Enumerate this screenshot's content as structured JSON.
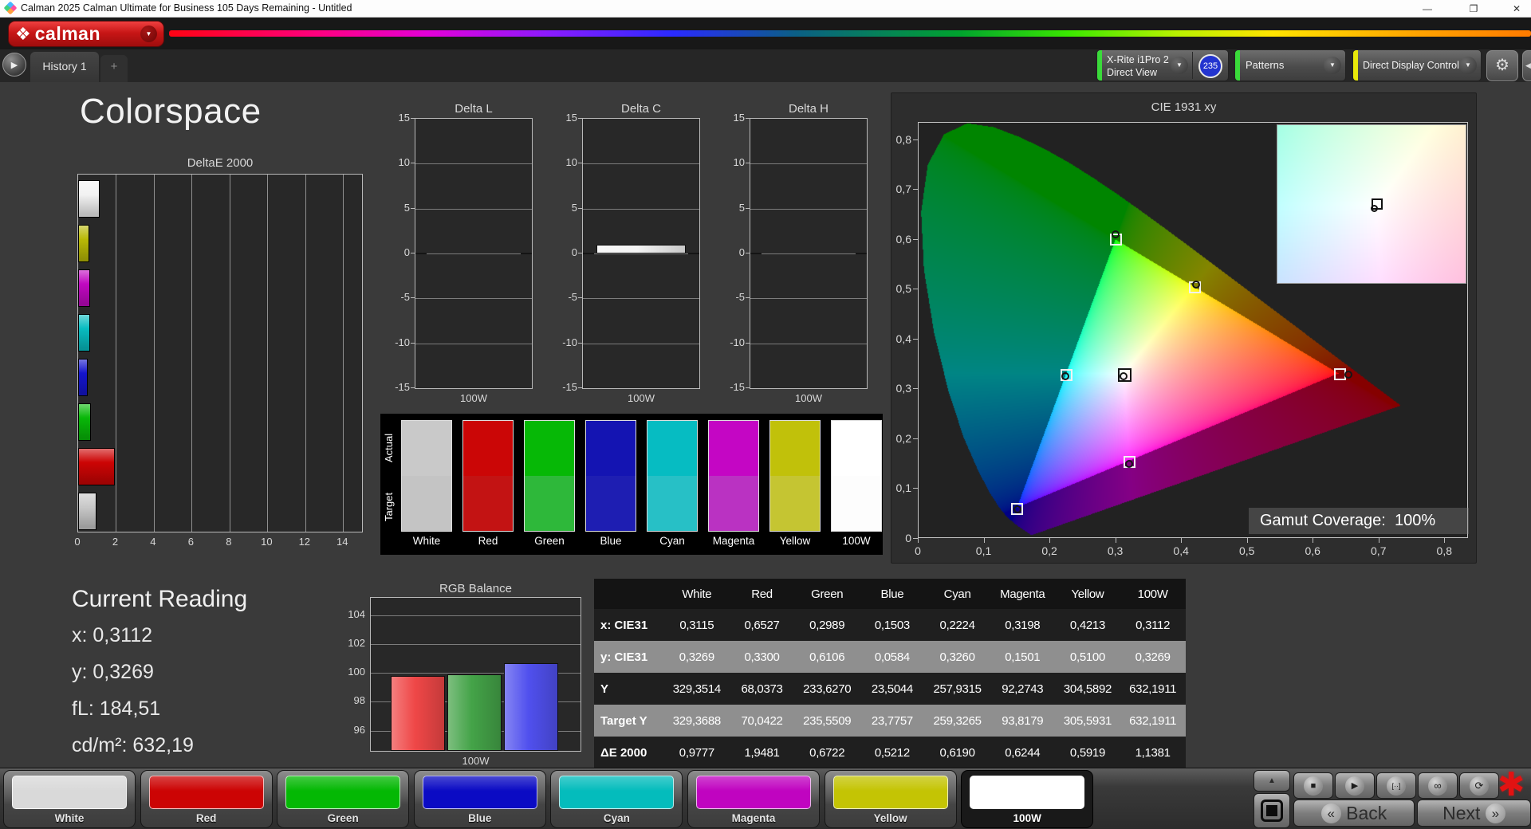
{
  "title_bar": {
    "title": "Calman 2025 Calman Ultimate for Business 105 Days Remaining  - Untitled"
  },
  "icons": {
    "logo_glyph": "❖",
    "chevron_down": "▼",
    "tab_arrow": "▶",
    "add": "+",
    "minimize": "—",
    "restore": "❐",
    "close": "✕",
    "gear": "⚙",
    "collapse_left": "◀",
    "up": "▲",
    "stop": "■",
    "play": "▶",
    "step": "[··]",
    "infinity": "∞",
    "loop": "⟳",
    "asterisk": "✱",
    "back_chevrons": "«",
    "next_chevrons": "»"
  },
  "header": {
    "logo_text": "calman"
  },
  "tab_bar": {
    "history_tab": "History 1",
    "add_tab": "+"
  },
  "toolbar": {
    "meter": {
      "line1": "X-Rite i1Pro 2",
      "line2": "Direct View",
      "badge": "235",
      "accent": "#3ada3a"
    },
    "patterns": {
      "label": "Patterns",
      "accent": "#3ada3a"
    },
    "display_control": {
      "label": "Direct Display Control",
      "accent": "#e8e80a"
    }
  },
  "page": {
    "title": "Colorspace"
  },
  "charts": {
    "delta_e": {
      "type": "bar",
      "title": "DeltaE 2000",
      "xlim": [
        0,
        15
      ],
      "x_ticks": [
        "0",
        "2",
        "4",
        "6",
        "8",
        "10",
        "12",
        "14"
      ],
      "bars": [
        {
          "name": "100W",
          "color": "#f2f2f2",
          "value": 1.1381
        },
        {
          "name": "Yellow",
          "color": "#b9b906",
          "value": 0.5919
        },
        {
          "name": "Magenta",
          "color": "#c008c0",
          "value": 0.6244
        },
        {
          "name": "Cyan",
          "color": "#08bcc0",
          "value": 0.619
        },
        {
          "name": "Blue",
          "color": "#1414cc",
          "value": 0.5212
        },
        {
          "name": "Green",
          "color": "#08b808",
          "value": 0.6722
        },
        {
          "name": "Red",
          "color": "#cc0404",
          "value": 1.9481
        },
        {
          "name": "White",
          "color": "#c8c8c8",
          "value": 0.9777
        }
      ]
    },
    "delta_lch": {
      "type": "bar",
      "ylim": [
        -15,
        15
      ],
      "y_ticks": [
        15,
        10,
        5,
        0,
        -5,
        -10,
        -15
      ],
      "xlabel": "100W",
      "charts": [
        {
          "title": "Delta L",
          "value": 0
        },
        {
          "title": "Delta C",
          "value": 1.0
        },
        {
          "title": "Delta H",
          "value": 0
        }
      ]
    },
    "actual_target": {
      "row_labels": [
        "Actual",
        "Target"
      ],
      "columns": [
        {
          "label": "White",
          "actual": "#c9c9c9",
          "target": "#c4c4c4"
        },
        {
          "label": "Red",
          "actual": "#cb0606",
          "target": "#c31313"
        },
        {
          "label": "Green",
          "actual": "#06b806",
          "target": "#2eb83a"
        },
        {
          "label": "Blue",
          "actual": "#1414b2",
          "target": "#1e1eb2"
        },
        {
          "label": "Cyan",
          "actual": "#06bcc2",
          "target": "#27c0c6"
        },
        {
          "label": "Magenta",
          "actual": "#c406c4",
          "target": "#ba32c2"
        },
        {
          "label": "Yellow",
          "actual": "#c1c10a",
          "target": "#c5c532"
        },
        {
          "label": "100W",
          "actual": "#ffffff",
          "target": "#fdfdfd"
        }
      ]
    },
    "rgb_balance": {
      "type": "bar",
      "title": "RGB Balance",
      "xlabel": "100W",
      "ylim": [
        94.6,
        105.2
      ],
      "y_ticks": [
        104,
        102,
        100,
        98,
        96
      ],
      "series": [
        {
          "name": "Red",
          "color": "#ef4747",
          "value": 99.8
        },
        {
          "name": "Green",
          "color": "#44a348",
          "value": 99.9
        },
        {
          "name": "Blue",
          "color": "#5050ee",
          "value": 100.7
        }
      ]
    }
  },
  "cie": {
    "type": "scatter",
    "title": "CIE 1931 xy",
    "xlim": [
      0,
      0.836
    ],
    "ylim": [
      0,
      0.835
    ],
    "x_tick_labels": [
      "0",
      "0,1",
      "0,2",
      "0,3",
      "0,4",
      "0,5",
      "0,6",
      "0,7",
      "0,8"
    ],
    "y_tick_labels": [
      "0",
      "0,1",
      "0,2",
      "0,3",
      "0,4",
      "0,5",
      "0,6",
      "0,7",
      "0,8"
    ],
    "coverage_label": "Gamut Coverage:",
    "coverage_value": "100%",
    "triangle": [
      [
        0.64,
        0.33
      ],
      [
        0.3,
        0.6
      ],
      [
        0.15,
        0.06
      ]
    ],
    "points": [
      {
        "name": "white",
        "target": [
          0.3127,
          0.329
        ],
        "actual": [
          0.3115,
          0.3269
        ],
        "ring": "#141414",
        "size": 17
      },
      {
        "name": "red",
        "target": [
          0.64,
          0.33
        ],
        "actual": [
          0.6527,
          0.33
        ],
        "ring": "#f2f2f2",
        "size": 15
      },
      {
        "name": "green",
        "target": [
          0.3,
          0.6
        ],
        "actual": [
          0.2989,
          0.6106
        ],
        "ring": "#f2f2f2",
        "size": 15
      },
      {
        "name": "blue",
        "target": [
          0.15,
          0.06
        ],
        "actual": [
          0.1503,
          0.0584
        ],
        "ring": "#f2f2f2",
        "size": 15
      },
      {
        "name": "cyan",
        "target": [
          0.2246,
          0.3287
        ],
        "actual": [
          0.2224,
          0.326
        ],
        "ring": "#f2f2f2",
        "size": 15
      },
      {
        "name": "magenta",
        "target": [
          0.3209,
          0.1542
        ],
        "actual": [
          0.3198,
          0.1501
        ],
        "ring": "#f2f2f2",
        "size": 15
      },
      {
        "name": "yellow",
        "target": [
          0.4193,
          0.5053
        ],
        "actual": [
          0.4213,
          0.51
        ],
        "ring": "#f2f2f2",
        "size": 15
      }
    ],
    "inset": {
      "xrange": [
        0.26,
        0.36
      ],
      "yrange": [
        0.28,
        0.38
      ],
      "target": [
        0.313,
        0.33
      ],
      "actual": [
        0.3115,
        0.3269
      ]
    },
    "locus": [
      [
        0.1741,
        0.005
      ],
      [
        0.1721,
        0.0048
      ],
      [
        0.1703,
        0.0058
      ],
      [
        0.1669,
        0.0086
      ],
      [
        0.1611,
        0.0138
      ],
      [
        0.151,
        0.0227
      ],
      [
        0.1355,
        0.0399
      ],
      [
        0.1241,
        0.0578
      ],
      [
        0.1096,
        0.0868
      ],
      [
        0.0913,
        0.1327
      ],
      [
        0.0687,
        0.2007
      ],
      [
        0.0454,
        0.295
      ],
      [
        0.0235,
        0.4127
      ],
      [
        0.0082,
        0.5384
      ],
      [
        0.0039,
        0.6548
      ],
      [
        0.0139,
        0.7502
      ],
      [
        0.0389,
        0.812
      ],
      [
        0.0743,
        0.8338
      ],
      [
        0.1142,
        0.8262
      ],
      [
        0.1547,
        0.8059
      ],
      [
        0.1929,
        0.7816
      ],
      [
        0.2296,
        0.7543
      ],
      [
        0.2658,
        0.7243
      ],
      [
        0.3016,
        0.6923
      ],
      [
        0.3373,
        0.6589
      ],
      [
        0.3731,
        0.6245
      ],
      [
        0.4087,
        0.5896
      ],
      [
        0.4441,
        0.5547
      ],
      [
        0.4788,
        0.5202
      ],
      [
        0.5125,
        0.4866
      ],
      [
        0.5448,
        0.4544
      ],
      [
        0.5752,
        0.4242
      ],
      [
        0.6029,
        0.3965
      ],
      [
        0.627,
        0.3725
      ],
      [
        0.6482,
        0.3514
      ],
      [
        0.6658,
        0.334
      ],
      [
        0.6915,
        0.3083
      ],
      [
        0.7079,
        0.292
      ],
      [
        0.719,
        0.2809
      ],
      [
        0.726,
        0.274
      ],
      [
        0.7347,
        0.2653
      ]
    ]
  },
  "current_reading": {
    "title": "Current Reading",
    "lines": [
      {
        "label": "x:",
        "value": "0,3112"
      },
      {
        "label": "y:",
        "value": "0,3269"
      },
      {
        "label": "fL:",
        "value": "184,51"
      },
      {
        "label": "cd/m²:",
        "value": "632,19"
      }
    ]
  },
  "table": {
    "headers": [
      "",
      "White",
      "Red",
      "Green",
      "Blue",
      "Cyan",
      "Magenta",
      "Yellow",
      "100W"
    ],
    "rows": [
      {
        "label": "x: CIE31",
        "shade": "dark",
        "values": [
          "0,3115",
          "0,6527",
          "0,2989",
          "0,1503",
          "0,2224",
          "0,3198",
          "0,4213",
          "0,3112"
        ]
      },
      {
        "label": "y: CIE31",
        "shade": "light",
        "values": [
          "0,3269",
          "0,3300",
          "0,6106",
          "0,0584",
          "0,3260",
          "0,1501",
          "0,5100",
          "0,3269"
        ]
      },
      {
        "label": "Y",
        "shade": "dark",
        "values": [
          "329,3514",
          "68,0373",
          "233,6270",
          "23,5044",
          "257,9315",
          "92,2743",
          "304,5892",
          "632,1911"
        ]
      },
      {
        "label": "Target Y",
        "shade": "light",
        "values": [
          "329,3688",
          "70,0422",
          "235,5509",
          "23,7757",
          "259,3265",
          "93,8179",
          "305,5931",
          "632,1911"
        ]
      },
      {
        "label": "ΔE 2000",
        "shade": "dark",
        "values": [
          "0,9777",
          "1,9481",
          "0,6722",
          "0,5212",
          "0,6190",
          "0,6244",
          "0,5919",
          "1,1381"
        ]
      }
    ],
    "shade_colors": {
      "dark": "#1f1f1f",
      "light": "#8f8f8f"
    }
  },
  "bottom_bar": {
    "buttons": [
      {
        "label": "White",
        "color": "#d9d9d9",
        "selected": false
      },
      {
        "label": "Red",
        "color": "#cc0404",
        "selected": false
      },
      {
        "label": "Green",
        "color": "#04b804",
        "selected": false
      },
      {
        "label": "Blue",
        "color": "#0b0bc4",
        "selected": false
      },
      {
        "label": "Cyan",
        "color": "#04bcbc",
        "selected": false
      },
      {
        "label": "Magenta",
        "color": "#c004c0",
        "selected": false
      },
      {
        "label": "Yellow",
        "color": "#c4c404",
        "selected": false
      },
      {
        "label": "100W",
        "color": "#ffffff",
        "selected": true
      }
    ],
    "transport": [
      "stop",
      "play",
      "step",
      "infinity",
      "loop"
    ],
    "back_label": "Back",
    "next_label": "Next"
  }
}
